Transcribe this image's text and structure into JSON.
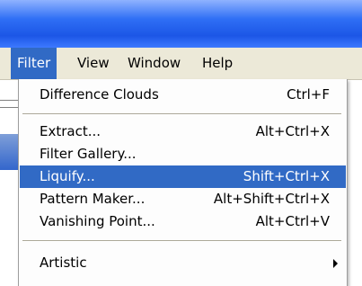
{
  "menubar": {
    "items": [
      {
        "label": "Filter",
        "active": true
      },
      {
        "label": "View"
      },
      {
        "label": "Window"
      },
      {
        "label": "Help"
      }
    ]
  },
  "filter_menu": {
    "items": [
      {
        "label": "Difference Clouds",
        "shortcut": "Ctrl+F"
      },
      {
        "label": "Extract...",
        "shortcut": "Alt+Ctrl+X"
      },
      {
        "label": "Filter Gallery...",
        "shortcut": ""
      },
      {
        "label": "Liquify...",
        "shortcut": "Shift+Ctrl+X",
        "highlighted": true
      },
      {
        "label": "Pattern Maker...",
        "shortcut": "Alt+Shift+Ctrl+X"
      },
      {
        "label": "Vanishing Point...",
        "shortcut": "Alt+Ctrl+V"
      },
      {
        "label": "Artistic",
        "submenu": true,
        "icon": "submenu-arrow-icon"
      }
    ]
  },
  "colors": {
    "highlight": "#316ac5",
    "menubar_bg": "#ece9d8",
    "titlebar": "#1c56e6"
  }
}
